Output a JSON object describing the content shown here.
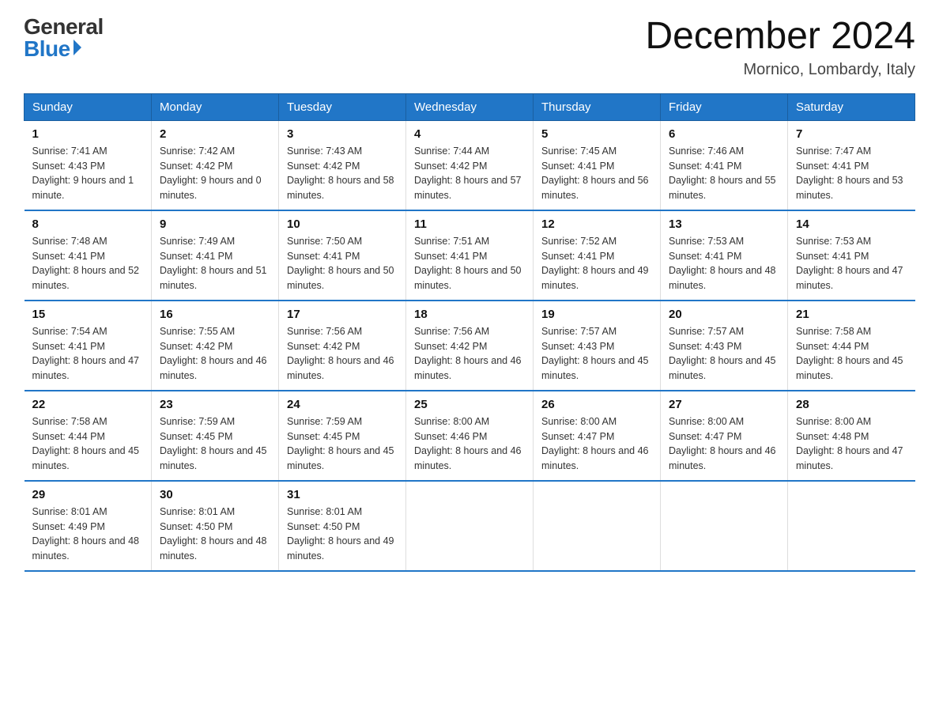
{
  "logo": {
    "general": "General",
    "blue": "Blue"
  },
  "title": "December 2024",
  "location": "Mornico, Lombardy, Italy",
  "headers": [
    "Sunday",
    "Monday",
    "Tuesday",
    "Wednesday",
    "Thursday",
    "Friday",
    "Saturday"
  ],
  "weeks": [
    [
      {
        "day": "1",
        "sunrise": "7:41 AM",
        "sunset": "4:43 PM",
        "daylight": "9 hours and 1 minute."
      },
      {
        "day": "2",
        "sunrise": "7:42 AM",
        "sunset": "4:42 PM",
        "daylight": "9 hours and 0 minutes."
      },
      {
        "day": "3",
        "sunrise": "7:43 AM",
        "sunset": "4:42 PM",
        "daylight": "8 hours and 58 minutes."
      },
      {
        "day": "4",
        "sunrise": "7:44 AM",
        "sunset": "4:42 PM",
        "daylight": "8 hours and 57 minutes."
      },
      {
        "day": "5",
        "sunrise": "7:45 AM",
        "sunset": "4:41 PM",
        "daylight": "8 hours and 56 minutes."
      },
      {
        "day": "6",
        "sunrise": "7:46 AM",
        "sunset": "4:41 PM",
        "daylight": "8 hours and 55 minutes."
      },
      {
        "day": "7",
        "sunrise": "7:47 AM",
        "sunset": "4:41 PM",
        "daylight": "8 hours and 53 minutes."
      }
    ],
    [
      {
        "day": "8",
        "sunrise": "7:48 AM",
        "sunset": "4:41 PM",
        "daylight": "8 hours and 52 minutes."
      },
      {
        "day": "9",
        "sunrise": "7:49 AM",
        "sunset": "4:41 PM",
        "daylight": "8 hours and 51 minutes."
      },
      {
        "day": "10",
        "sunrise": "7:50 AM",
        "sunset": "4:41 PM",
        "daylight": "8 hours and 50 minutes."
      },
      {
        "day": "11",
        "sunrise": "7:51 AM",
        "sunset": "4:41 PM",
        "daylight": "8 hours and 50 minutes."
      },
      {
        "day": "12",
        "sunrise": "7:52 AM",
        "sunset": "4:41 PM",
        "daylight": "8 hours and 49 minutes."
      },
      {
        "day": "13",
        "sunrise": "7:53 AM",
        "sunset": "4:41 PM",
        "daylight": "8 hours and 48 minutes."
      },
      {
        "day": "14",
        "sunrise": "7:53 AM",
        "sunset": "4:41 PM",
        "daylight": "8 hours and 47 minutes."
      }
    ],
    [
      {
        "day": "15",
        "sunrise": "7:54 AM",
        "sunset": "4:41 PM",
        "daylight": "8 hours and 47 minutes."
      },
      {
        "day": "16",
        "sunrise": "7:55 AM",
        "sunset": "4:42 PM",
        "daylight": "8 hours and 46 minutes."
      },
      {
        "day": "17",
        "sunrise": "7:56 AM",
        "sunset": "4:42 PM",
        "daylight": "8 hours and 46 minutes."
      },
      {
        "day": "18",
        "sunrise": "7:56 AM",
        "sunset": "4:42 PM",
        "daylight": "8 hours and 46 minutes."
      },
      {
        "day": "19",
        "sunrise": "7:57 AM",
        "sunset": "4:43 PM",
        "daylight": "8 hours and 45 minutes."
      },
      {
        "day": "20",
        "sunrise": "7:57 AM",
        "sunset": "4:43 PM",
        "daylight": "8 hours and 45 minutes."
      },
      {
        "day": "21",
        "sunrise": "7:58 AM",
        "sunset": "4:44 PM",
        "daylight": "8 hours and 45 minutes."
      }
    ],
    [
      {
        "day": "22",
        "sunrise": "7:58 AM",
        "sunset": "4:44 PM",
        "daylight": "8 hours and 45 minutes."
      },
      {
        "day": "23",
        "sunrise": "7:59 AM",
        "sunset": "4:45 PM",
        "daylight": "8 hours and 45 minutes."
      },
      {
        "day": "24",
        "sunrise": "7:59 AM",
        "sunset": "4:45 PM",
        "daylight": "8 hours and 45 minutes."
      },
      {
        "day": "25",
        "sunrise": "8:00 AM",
        "sunset": "4:46 PM",
        "daylight": "8 hours and 46 minutes."
      },
      {
        "day": "26",
        "sunrise": "8:00 AM",
        "sunset": "4:47 PM",
        "daylight": "8 hours and 46 minutes."
      },
      {
        "day": "27",
        "sunrise": "8:00 AM",
        "sunset": "4:47 PM",
        "daylight": "8 hours and 46 minutes."
      },
      {
        "day": "28",
        "sunrise": "8:00 AM",
        "sunset": "4:48 PM",
        "daylight": "8 hours and 47 minutes."
      }
    ],
    [
      {
        "day": "29",
        "sunrise": "8:01 AM",
        "sunset": "4:49 PM",
        "daylight": "8 hours and 48 minutes."
      },
      {
        "day": "30",
        "sunrise": "8:01 AM",
        "sunset": "4:50 PM",
        "daylight": "8 hours and 48 minutes."
      },
      {
        "day": "31",
        "sunrise": "8:01 AM",
        "sunset": "4:50 PM",
        "daylight": "8 hours and 49 minutes."
      },
      null,
      null,
      null,
      null
    ]
  ]
}
